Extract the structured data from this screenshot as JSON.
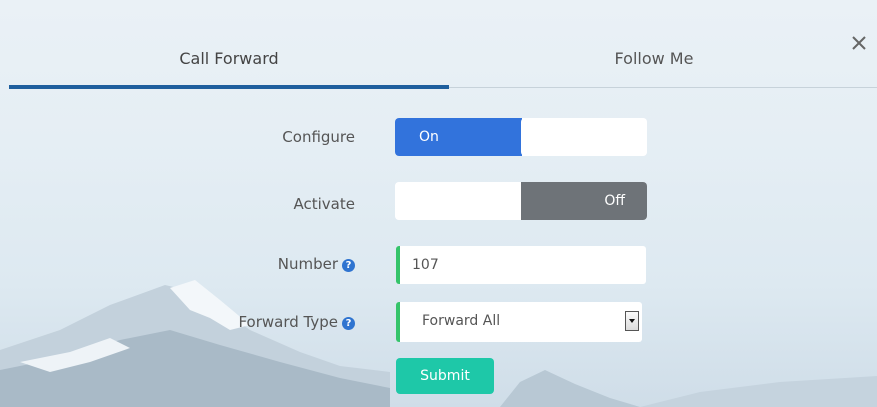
{
  "tabs": [
    {
      "label": "Call Forward",
      "active": true
    },
    {
      "label": "Follow Me",
      "active": false
    }
  ],
  "close_icon": "close-icon",
  "form": {
    "configure": {
      "label": "Configure",
      "state_label": "On",
      "state": "on"
    },
    "activate": {
      "label": "Activate",
      "state_label": "Off",
      "state": "off"
    },
    "number": {
      "label": "Number",
      "value": "107",
      "help_icon": "question-icon"
    },
    "forward_type": {
      "label": "Forward Type",
      "value": "Forward All",
      "help_icon": "question-icon"
    },
    "submit_label": "Submit"
  },
  "colors": {
    "active_tab": "#1f5f9e",
    "toggle_on": "#3273dc",
    "toggle_off": "#6e7378",
    "input_accent": "#35c46a",
    "submit": "#1ec8a8"
  }
}
